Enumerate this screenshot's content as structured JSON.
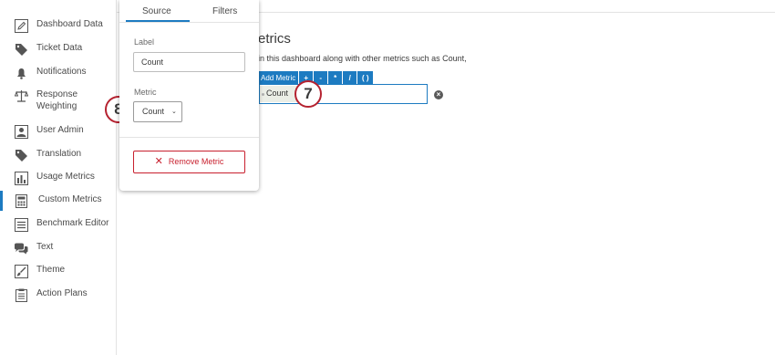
{
  "sidebar": {
    "items": [
      {
        "label": "Dashboard Data",
        "icon": "pencil-icon",
        "active": false
      },
      {
        "label": "Ticket Data",
        "icon": "tag-icon",
        "active": false
      },
      {
        "label": "Notifications",
        "icon": "bell-icon",
        "active": false
      },
      {
        "label": "Response Weighting",
        "icon": "scale-icon",
        "active": false
      },
      {
        "label": "User Admin",
        "icon": "user-icon",
        "active": false
      },
      {
        "label": "Translation",
        "icon": "tag-icon",
        "active": false
      },
      {
        "label": "Usage Metrics",
        "icon": "bar-chart-icon",
        "active": false
      },
      {
        "label": "Custom Metrics",
        "icon": "calculator-icon",
        "active": true
      },
      {
        "label": "Benchmark Editor",
        "icon": "list-icon",
        "active": false
      },
      {
        "label": "Text",
        "icon": "speech-bubbles-icon",
        "active": false
      },
      {
        "label": "Theme",
        "icon": "paint-brush-icon",
        "active": false
      },
      {
        "label": "Action Plans",
        "icon": "clipboard-icon",
        "active": false
      }
    ],
    "accent": "#1d7bc1"
  },
  "main": {
    "title_partial": "etrics",
    "description_partial": "in this dashboard along with other metrics such as Count,",
    "add_metric_label": "Add Metric",
    "operators": [
      "+",
      "-",
      "*",
      "/",
      "( )"
    ],
    "formula_token": "Count",
    "clear_icon": "clear-circle-icon"
  },
  "popover": {
    "tabs": [
      {
        "label": "Source",
        "active": true
      },
      {
        "label": "Filters",
        "active": false
      }
    ],
    "label_caption": "Label",
    "label_value": "Count",
    "metric_caption": "Metric",
    "metric_value": "Count",
    "remove_label": "Remove Metric",
    "danger_color": "#c8202e"
  },
  "callouts": {
    "step_seven": "7",
    "step_eight": "8",
    "color": "#b52230"
  }
}
